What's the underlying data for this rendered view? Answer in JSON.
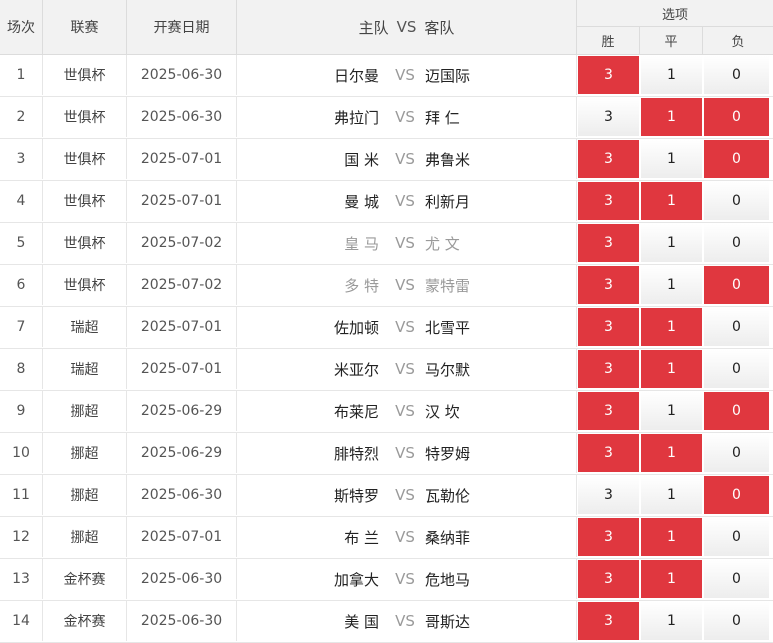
{
  "header": {
    "match_no": "场次",
    "league": "联赛",
    "date": "开赛日期",
    "home": "主队",
    "vs": "VS",
    "away": "客队",
    "options": "选项",
    "win": "胜",
    "draw": "平",
    "lose": "负"
  },
  "colors": {
    "selected": "#e0373f",
    "muted_team": "#9a9a9a"
  },
  "rows": [
    {
      "no": "1",
      "league": "世俱杯",
      "date": "2025-06-30",
      "home": "日尔曼",
      "vs": "VS",
      "away": "迈国际",
      "muted": false,
      "win": "3",
      "draw": "1",
      "lose": "0",
      "sel": [
        true,
        false,
        false
      ]
    },
    {
      "no": "2",
      "league": "世俱杯",
      "date": "2025-06-30",
      "home": "弗拉门",
      "vs": "VS",
      "away": "拜 仁",
      "muted": false,
      "win": "3",
      "draw": "1",
      "lose": "0",
      "sel": [
        false,
        true,
        true
      ]
    },
    {
      "no": "3",
      "league": "世俱杯",
      "date": "2025-07-01",
      "home": "国 米",
      "vs": "VS",
      "away": "弗鲁米",
      "muted": false,
      "win": "3",
      "draw": "1",
      "lose": "0",
      "sel": [
        true,
        false,
        true
      ]
    },
    {
      "no": "4",
      "league": "世俱杯",
      "date": "2025-07-01",
      "home": "曼 城",
      "vs": "VS",
      "away": "利新月",
      "muted": false,
      "win": "3",
      "draw": "1",
      "lose": "0",
      "sel": [
        true,
        true,
        false
      ]
    },
    {
      "no": "5",
      "league": "世俱杯",
      "date": "2025-07-02",
      "home": "皇 马",
      "vs": "VS",
      "away": "尤 文",
      "muted": true,
      "win": "3",
      "draw": "1",
      "lose": "0",
      "sel": [
        true,
        false,
        false
      ]
    },
    {
      "no": "6",
      "league": "世俱杯",
      "date": "2025-07-02",
      "home": "多 特",
      "vs": "VS",
      "away": "蒙特雷",
      "muted": true,
      "win": "3",
      "draw": "1",
      "lose": "0",
      "sel": [
        true,
        false,
        true
      ]
    },
    {
      "no": "7",
      "league": "瑞超",
      "date": "2025-07-01",
      "home": "佐加顿",
      "vs": "VS",
      "away": "北雪平",
      "muted": false,
      "win": "3",
      "draw": "1",
      "lose": "0",
      "sel": [
        true,
        true,
        false
      ]
    },
    {
      "no": "8",
      "league": "瑞超",
      "date": "2025-07-01",
      "home": "米亚尔",
      "vs": "VS",
      "away": "马尔默",
      "muted": false,
      "win": "3",
      "draw": "1",
      "lose": "0",
      "sel": [
        true,
        true,
        false
      ]
    },
    {
      "no": "9",
      "league": "挪超",
      "date": "2025-06-29",
      "home": "布莱尼",
      "vs": "VS",
      "away": "汉 坎",
      "muted": false,
      "win": "3",
      "draw": "1",
      "lose": "0",
      "sel": [
        true,
        false,
        true
      ]
    },
    {
      "no": "10",
      "league": "挪超",
      "date": "2025-06-29",
      "home": "腓特烈",
      "vs": "VS",
      "away": "特罗姆",
      "muted": false,
      "win": "3",
      "draw": "1",
      "lose": "0",
      "sel": [
        true,
        true,
        false
      ]
    },
    {
      "no": "11",
      "league": "挪超",
      "date": "2025-06-30",
      "home": "斯特罗",
      "vs": "VS",
      "away": "瓦勒伦",
      "muted": false,
      "win": "3",
      "draw": "1",
      "lose": "0",
      "sel": [
        false,
        false,
        true
      ]
    },
    {
      "no": "12",
      "league": "挪超",
      "date": "2025-07-01",
      "home": "布 兰",
      "vs": "VS",
      "away": "桑纳菲",
      "muted": false,
      "win": "3",
      "draw": "1",
      "lose": "0",
      "sel": [
        true,
        true,
        false
      ]
    },
    {
      "no": "13",
      "league": "金杯赛",
      "date": "2025-06-30",
      "home": "加拿大",
      "vs": "VS",
      "away": "危地马",
      "muted": false,
      "win": "3",
      "draw": "1",
      "lose": "0",
      "sel": [
        true,
        true,
        false
      ]
    },
    {
      "no": "14",
      "league": "金杯赛",
      "date": "2025-06-30",
      "home": "美 国",
      "vs": "VS",
      "away": "哥斯达",
      "muted": false,
      "win": "3",
      "draw": "1",
      "lose": "0",
      "sel": [
        true,
        false,
        false
      ]
    }
  ]
}
